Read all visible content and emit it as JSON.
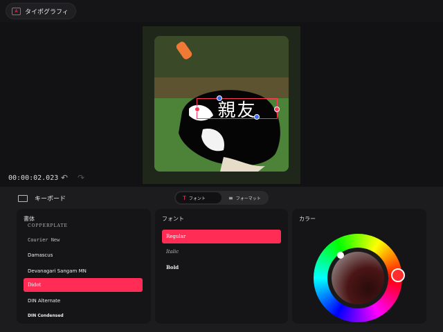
{
  "header": {
    "title": "タイポグラフィ",
    "icon": "typography-app-icon"
  },
  "preview": {
    "caption": "親友",
    "timecode": "00:00:02.023"
  },
  "panel": {
    "keyboard_label": "キーボード",
    "tabs": [
      {
        "label": "フォント",
        "active": true
      },
      {
        "label": "フォーマット",
        "active": false
      }
    ]
  },
  "typeface_card": {
    "title": "書体",
    "items": [
      {
        "label": "Copperplate",
        "selected": false
      },
      {
        "label": "Courier New",
        "selected": false
      },
      {
        "label": "Damascus",
        "selected": false
      },
      {
        "label": "Devanagari Sangam MN",
        "selected": false
      },
      {
        "label": "Didot",
        "selected": true
      },
      {
        "label": "DIN Alternate",
        "selected": false
      },
      {
        "label": "DIN Condensed",
        "selected": false
      }
    ]
  },
  "font_card": {
    "title": "フォント",
    "items": [
      {
        "label": "Regular",
        "selected": true
      },
      {
        "label": "Italic",
        "selected": false
      },
      {
        "label": "Bold",
        "selected": false
      }
    ]
  },
  "color_card": {
    "title": "カラー",
    "accent": "#ff2d55"
  }
}
